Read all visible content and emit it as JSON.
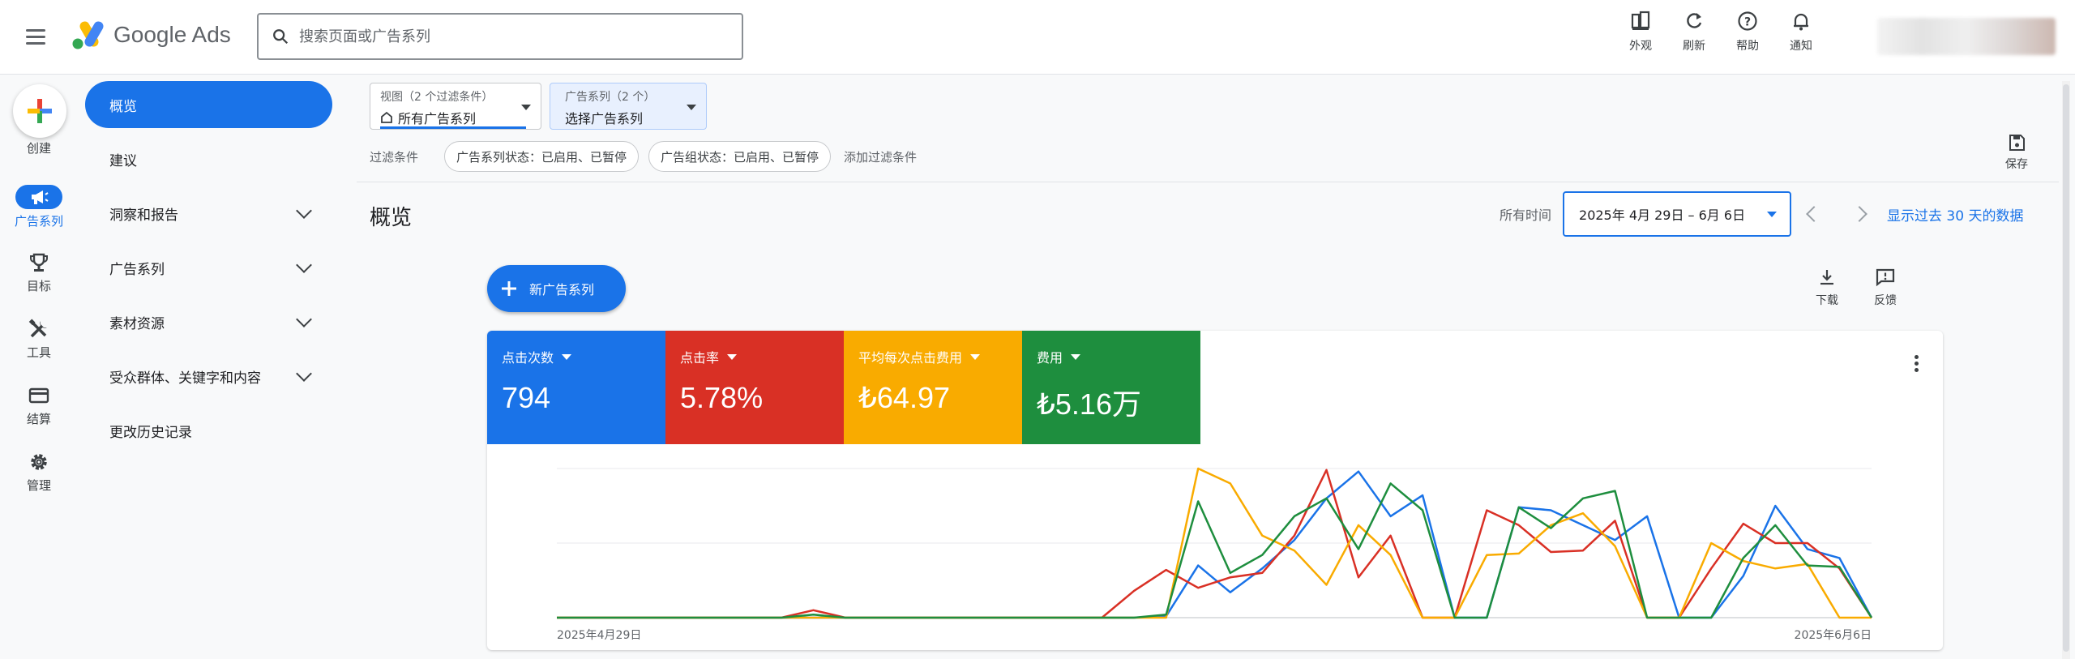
{
  "header": {
    "logo_text": "Google Ads",
    "search_placeholder": "搜索页面或广告系列",
    "actions": [
      {
        "label": "外观",
        "icon": "appearance-icon"
      },
      {
        "label": "刷新",
        "icon": "refresh-icon"
      },
      {
        "label": "帮助",
        "icon": "help-icon"
      },
      {
        "label": "通知",
        "icon": "bell-icon"
      }
    ]
  },
  "rail": {
    "create": "创建",
    "items": [
      {
        "label": "广告系列",
        "icon": "megaphone-icon",
        "active": true
      },
      {
        "label": "目标",
        "icon": "trophy-icon"
      },
      {
        "label": "工具",
        "icon": "tools-icon"
      },
      {
        "label": "结算",
        "icon": "billing-icon"
      },
      {
        "label": "管理",
        "icon": "gear-icon"
      }
    ]
  },
  "sidenav": {
    "items": [
      {
        "label": "概览",
        "active": true,
        "expandable": false
      },
      {
        "label": "建议",
        "expandable": false
      },
      {
        "label": "洞察和报告",
        "expandable": true
      },
      {
        "label": "广告系列",
        "expandable": true
      },
      {
        "label": "素材资源",
        "expandable": true
      },
      {
        "label": "受众群体、关键字和内容",
        "expandable": true
      },
      {
        "label": "更改历史记录",
        "expandable": false
      }
    ]
  },
  "filters": {
    "view_caption": "视图（2 个过滤条件）",
    "view_value": "所有广告系列",
    "campaign_caption": "广告系列（2 个）",
    "campaign_value": "选择广告系列",
    "filter_label": "过滤条件",
    "chips": [
      "广告系列状态：已启用、已暂停",
      "广告组状态：已启用、已暂停"
    ],
    "add_filter": "添加过滤条件",
    "save_label": "保存"
  },
  "overview": {
    "title": "概览",
    "date_caption": "所有时间",
    "date_range": "2025年 4月 29日 – 6月 6日",
    "last_30": "显示过去 30 天的数据",
    "new_campaign": "新广告系列",
    "download": "下载",
    "feedback": "反馈"
  },
  "metrics": [
    {
      "name": "点击次数",
      "value": "794",
      "color": "#1a73e8"
    },
    {
      "name": "点击率",
      "value": "5.78%",
      "color": "#d93025"
    },
    {
      "name": "平均每次点击费用",
      "value": "₺64.97",
      "color": "#f9ab00"
    },
    {
      "name": "费用",
      "value": "₺5.16万",
      "color": "#1e8e3e"
    }
  ],
  "chart_data": {
    "type": "line",
    "x_start_label": "2025年4月29日",
    "x_end_label": "2025年6月6日",
    "ylim": [
      0,
      1
    ],
    "series": [
      {
        "color": "#1a73e8",
        "values": [
          0,
          0,
          0,
          0,
          0,
          0,
          0,
          0,
          0,
          0,
          0,
          0,
          0,
          0,
          0,
          0,
          0,
          0,
          0,
          0.01,
          0.35,
          0.17,
          0.33,
          0.52,
          0.8,
          0.98,
          0.68,
          0.82,
          0,
          0,
          0.74,
          0.72,
          0.62,
          0.52,
          0.68,
          0,
          0,
          0.28,
          0.75,
          0.46,
          0.4,
          0
        ]
      },
      {
        "color": "#d93025",
        "values": [
          0,
          0,
          0,
          0,
          0,
          0,
          0,
          0,
          0.05,
          0,
          0,
          0,
          0,
          0,
          0,
          0,
          0,
          0,
          0.18,
          0.32,
          0.2,
          0.27,
          0.3,
          0.55,
          0.99,
          0.27,
          0.55,
          0,
          0,
          0.72,
          0.62,
          0.44,
          0.45,
          0.65,
          0,
          0,
          0.33,
          0.63,
          0.5,
          0.5,
          0.33,
          0
        ]
      },
      {
        "color": "#f9ab00",
        "values": [
          0,
          0,
          0,
          0,
          0,
          0,
          0,
          0,
          0,
          0,
          0,
          0,
          0,
          0,
          0,
          0,
          0,
          0,
          0,
          0,
          1.0,
          0.9,
          0.55,
          0.45,
          0.22,
          0.62,
          0.42,
          0,
          0,
          0.42,
          0.43,
          0.62,
          0.7,
          0.48,
          0,
          0,
          0.5,
          0.38,
          0.33,
          0.36,
          0,
          0
        ]
      },
      {
        "color": "#1e8e3e",
        "values": [
          0,
          0,
          0,
          0,
          0,
          0,
          0,
          0,
          0.02,
          0,
          0,
          0,
          0,
          0,
          0,
          0,
          0,
          0,
          0,
          0.02,
          0.78,
          0.3,
          0.42,
          0.68,
          0.8,
          0.46,
          0.9,
          0.72,
          0,
          0,
          0.74,
          0.6,
          0.8,
          0.85,
          0,
          0,
          0,
          0.4,
          0.62,
          0.35,
          0.34,
          0
        ]
      }
    ]
  }
}
